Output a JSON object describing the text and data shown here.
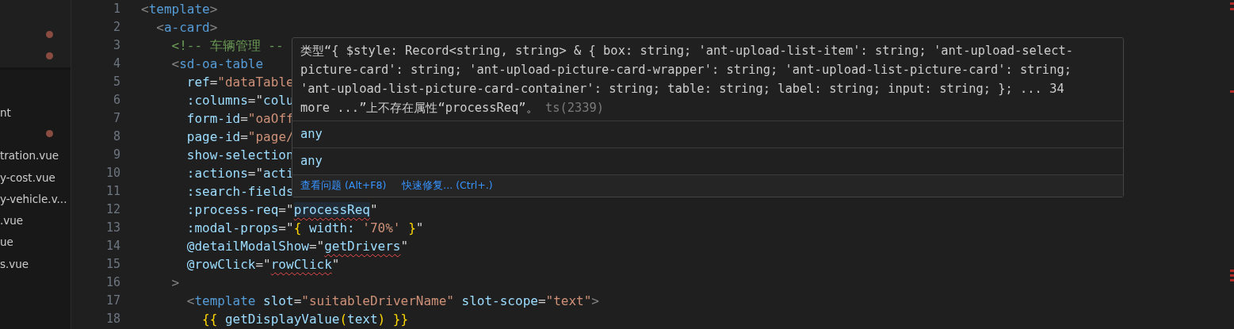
{
  "sidebar": {
    "open_editors": [
      {
        "modified": true
      },
      {
        "modified": true
      }
    ],
    "files": [
      {
        "label": "nt"
      },
      {
        "modified": true
      },
      {
        "label": "tration.vue"
      },
      {
        "label": "y-cost.vue"
      },
      {
        "label": "y-vehicle.v..."
      },
      {
        "label": ".vue"
      },
      {
        "label": "ue"
      },
      {
        "label": "s.vue"
      }
    ]
  },
  "editor": {
    "lines": [
      {
        "number": "1",
        "tokens": [
          {
            "kind": "bracket",
            "text": "<"
          },
          {
            "kind": "tag",
            "text": "template"
          },
          {
            "kind": "bracket",
            "text": ">"
          }
        ],
        "children": [
          {
            "number": "2",
            "tokens": [
              {
                "kind": "bracket",
                "text": "<"
              },
              {
                "kind": "tag",
                "text": "a-card"
              },
              {
                "kind": "bracket",
                "text": ">"
              }
            ],
            "children": [
              {
                "number": "3",
                "tokens": [
                  {
                    "kind": "comment",
                    "text": "<!-- 车辆管理 --"
                  }
                ]
              },
              {
                "number": "4",
                "tokens": [
                  {
                    "kind": "bracket",
                    "text": "<"
                  },
                  {
                    "kind": "tag",
                    "text": "sd-oa-table"
                  }
                ],
                "children": [
                  {
                    "number": "5",
                    "tokens": [
                      {
                        "kind": "attr",
                        "text": "ref"
                      },
                      {
                        "kind": "punct",
                        "text": "="
                      },
                      {
                        "kind": "string",
                        "text": "\"dataTable"
                      }
                    ]
                  },
                  {
                    "number": "6",
                    "tokens": [
                      {
                        "kind": "attr",
                        "text": ":columns"
                      },
                      {
                        "kind": "punct",
                        "text": "=\""
                      },
                      {
                        "kind": "attr",
                        "text": "colu"
                      }
                    ]
                  },
                  {
                    "number": "7",
                    "tokens": [
                      {
                        "kind": "attr",
                        "text": "form-id"
                      },
                      {
                        "kind": "punct",
                        "text": "="
                      },
                      {
                        "kind": "string",
                        "text": "\"oaOff"
                      }
                    ]
                  },
                  {
                    "number": "8",
                    "tokens": [
                      {
                        "kind": "attr",
                        "text": "page-id"
                      },
                      {
                        "kind": "punct",
                        "text": "="
                      },
                      {
                        "kind": "string",
                        "text": "\"page/"
                      }
                    ]
                  },
                  {
                    "number": "9",
                    "tokens": [
                      {
                        "kind": "attr",
                        "text": "show-selection"
                      }
                    ]
                  },
                  {
                    "number": "10",
                    "tokens": [
                      {
                        "kind": "attr",
                        "text": ":actions"
                      },
                      {
                        "kind": "punct",
                        "text": "=\""
                      },
                      {
                        "kind": "attr",
                        "text": "acti"
                      }
                    ]
                  },
                  {
                    "number": "11",
                    "tokens": [
                      {
                        "kind": "attr",
                        "text": ":search-fields"
                      }
                    ]
                  },
                  {
                    "number": "12",
                    "tokens": [
                      {
                        "kind": "attr",
                        "text": ":process-req"
                      },
                      {
                        "kind": "punct",
                        "text": "=\""
                      },
                      {
                        "kind": "attr",
                        "text": "processReq",
                        "error": true,
                        "highlighted": true
                      },
                      {
                        "kind": "punct",
                        "text": "\""
                      }
                    ]
                  },
                  {
                    "number": "13",
                    "tokens": [
                      {
                        "kind": "attr",
                        "text": ":modal-props"
                      },
                      {
                        "kind": "punct",
                        "text": "=\""
                      },
                      {
                        "kind": "brace",
                        "text": "{"
                      },
                      {
                        "kind": "attr",
                        "text": " width: "
                      },
                      {
                        "kind": "string",
                        "text": "'70%'"
                      },
                      {
                        "kind": "brace",
                        "text": " }"
                      },
                      {
                        "kind": "punct",
                        "text": "\""
                      }
                    ]
                  },
                  {
                    "number": "14",
                    "tokens": [
                      {
                        "kind": "attr",
                        "text": "@detailModalShow"
                      },
                      {
                        "kind": "punct",
                        "text": "=\""
                      },
                      {
                        "kind": "attr",
                        "text": "getDrivers",
                        "error": true
                      },
                      {
                        "kind": "punct",
                        "text": "\""
                      }
                    ]
                  },
                  {
                    "number": "15",
                    "tokens": [
                      {
                        "kind": "attr",
                        "text": "@rowClick"
                      },
                      {
                        "kind": "punct",
                        "text": "=\""
                      },
                      {
                        "kind": "attr",
                        "text": "rowClick",
                        "error": true
                      },
                      {
                        "kind": "punct",
                        "text": "\""
                      }
                    ]
                  }
                ]
              },
              {
                "number": "16",
                "tokens": [
                  {
                    "kind": "bracket",
                    "text": ">"
                  }
                ],
                "children": [
                  {
                    "number": "17",
                    "tokens": [
                      {
                        "kind": "bracket",
                        "text": "<"
                      },
                      {
                        "kind": "tag",
                        "text": "template"
                      },
                      {
                        "kind": "attr",
                        "text": " slot"
                      },
                      {
                        "kind": "punct",
                        "text": "="
                      },
                      {
                        "kind": "string",
                        "text": "\"suitableDriverName\""
                      },
                      {
                        "kind": "attr",
                        "text": " slot-scope"
                      },
                      {
                        "kind": "punct",
                        "text": "="
                      },
                      {
                        "kind": "string",
                        "text": "\"text\""
                      },
                      {
                        "kind": "bracket",
                        "text": ">"
                      }
                    ],
                    "children": [
                      {
                        "number": "18",
                        "tokens": [
                          {
                            "kind": "brace",
                            "text": "{{"
                          },
                          {
                            "kind": "attr",
                            "text": " getDisplayValue"
                          },
                          {
                            "kind": "brace",
                            "text": "("
                          },
                          {
                            "kind": "attr",
                            "text": "text"
                          },
                          {
                            "kind": "brace",
                            "text": ")"
                          },
                          {
                            "kind": "brace",
                            "text": " }}"
                          }
                        ]
                      }
                    ]
                  }
                ]
              }
            ]
          }
        ]
      }
    ]
  },
  "hover": {
    "message_lines": [
      "类型“{ $style: Record<string, string> & { box: string; 'ant-upload-list-item': string; 'ant-upload-select-",
      "picture-card': string; 'ant-upload-picture-card-wrapper': string; 'ant-upload-list-picture-card': string;",
      "'ant-upload-list-picture-card-container': string; table: string; label: string; input: string; }; ... 34",
      "more ...”上不存在属性“processReq”。"
    ],
    "code": "ts(2339)",
    "types": [
      "any",
      "any"
    ],
    "actions": [
      "查看问题 (Alt+F8)",
      "快速修复... (Ctrl+.)"
    ]
  }
}
